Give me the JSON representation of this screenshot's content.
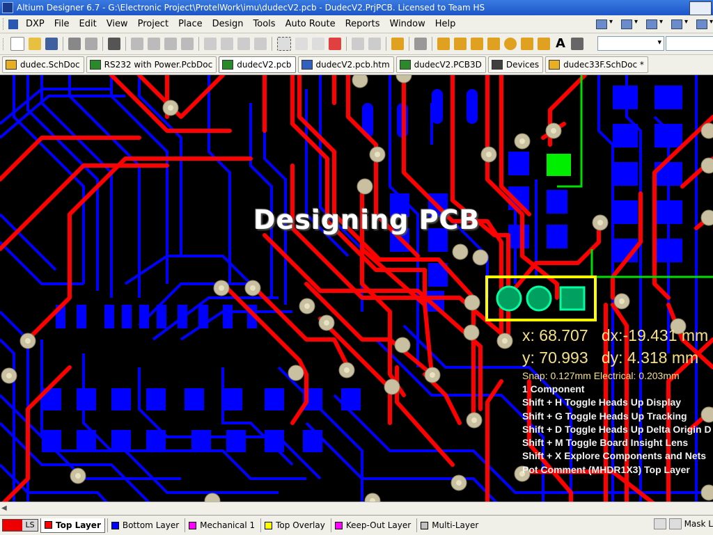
{
  "window": {
    "title": "Altium Designer 6.7 - G:\\Electronic Project\\ProtelWork\\imu\\dudecV2.pcb - DudecV2.PrjPCB. Licensed to Team HS"
  },
  "menu": {
    "items": [
      "DXP",
      "File",
      "Edit",
      "View",
      "Project",
      "Place",
      "Design",
      "Tools",
      "Auto Route",
      "Reports",
      "Window",
      "Help"
    ]
  },
  "doc_tabs": [
    {
      "label": "dudec.SchDoc",
      "icon": "schematic-icon",
      "color": "#e8b020"
    },
    {
      "label": "RS232 with Power.PcbDoc",
      "icon": "pcb-icon",
      "color": "#2a8a2a"
    },
    {
      "label": "dudecV2.pcb",
      "icon": "pcb-icon",
      "color": "#2a8a2a"
    },
    {
      "label": "dudecV2.pcb.htm",
      "icon": "html-icon",
      "color": "#3060c0"
    },
    {
      "label": "dudecV2.PCB3D",
      "icon": "pcb3d-icon",
      "color": "#2a8a2a"
    },
    {
      "label": "Devices",
      "icon": "devices-icon",
      "color": "#404040"
    },
    {
      "label": "dudec33F.SchDoc *",
      "icon": "schematic-icon",
      "color": "#e8b020"
    }
  ],
  "overlay_title": "Designing PCB",
  "hud": {
    "x": "x: 68.707",
    "dx": "dx:-19.431 mm",
    "y": "y: 70.993",
    "dy": "dy:  4.318  mm",
    "snap": "Snap: 0.127mm Electrical: 0.203mm",
    "lines": [
      "1 Component",
      "Shift + H  Toggle Heads Up Display",
      "Shift + G  Toggle Heads Up Tracking",
      "Shift + D  Toggle Heads Up Delta Origin D",
      "Shift + M  Toggle Board Insight Lens",
      "Shift + X  Explore Components and Nets",
      "Pot Comment (MHDR1X3) Top Layer"
    ]
  },
  "layers": {
    "ls_label": "LS",
    "tabs": [
      {
        "label": "Top Layer",
        "color": "#ff0000",
        "active": true
      },
      {
        "label": "Bottom Layer",
        "color": "#0000ff",
        "active": false
      },
      {
        "label": "Mechanical 1",
        "color": "#ff00ff",
        "active": false
      },
      {
        "label": "Top Overlay",
        "color": "#ffff00",
        "active": false
      },
      {
        "label": "Keep-Out Layer",
        "color": "#ff00ff",
        "active": false
      },
      {
        "label": "Multi-Layer",
        "color": "#c0c0c0",
        "active": false
      }
    ],
    "mask_label": "Mask L"
  },
  "colors": {
    "top_layer": "#ff0000",
    "bottom_layer": "#0000ff",
    "overlay": "#ffff00",
    "keepout": "#00dd00",
    "via": "#c8c0a0"
  }
}
